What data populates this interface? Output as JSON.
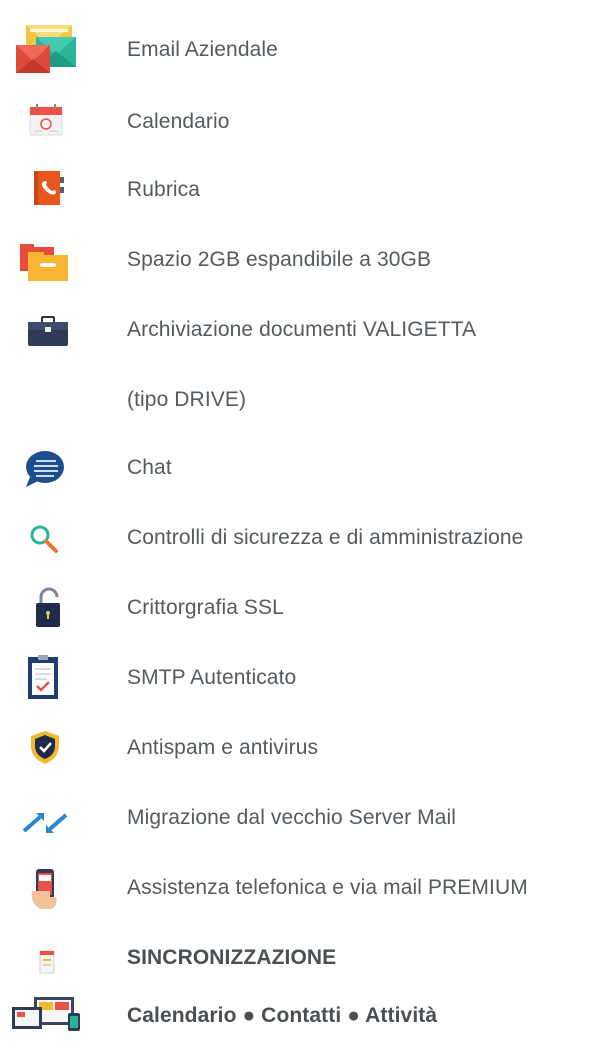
{
  "features": {
    "email": "Email Aziendale",
    "calendar": "Calendario",
    "contacts": "Rubrica",
    "storage": "Spazio 2GB espandibile a 30GB",
    "archive": "Archiviazione documenti VALIGETTA",
    "archive_sub": "(tipo DRIVE)",
    "chat": "Chat",
    "security_checks": "Controlli di sicurezza e di amministrazione",
    "ssl": "Crittorgrafia SSL",
    "smtp": "SMTP Autenticato",
    "antispam": "Antispam e antivirus",
    "migration": "Migrazione dal vecchio Server Mail",
    "support": "Assistenza telefonica e via mail  PREMIUM",
    "sync_title": "SINCRONIZZAZIONE",
    "sync_items": "Calendario ● Contatti ● Attività"
  },
  "icons": {
    "email": "email-envelopes-icon",
    "calendar": "calendar-icon",
    "contacts": "address-book-icon",
    "storage": "folders-icon",
    "archive": "briefcase-icon",
    "chat": "chat-bubble-icon",
    "security_checks": "magnifier-icon",
    "ssl": "padlock-icon",
    "smtp": "clipboard-check-icon",
    "antispam": "shield-check-icon",
    "migration": "migration-arrows-icon",
    "support": "phone-hand-icon",
    "sync": "sync-devices-icon"
  }
}
